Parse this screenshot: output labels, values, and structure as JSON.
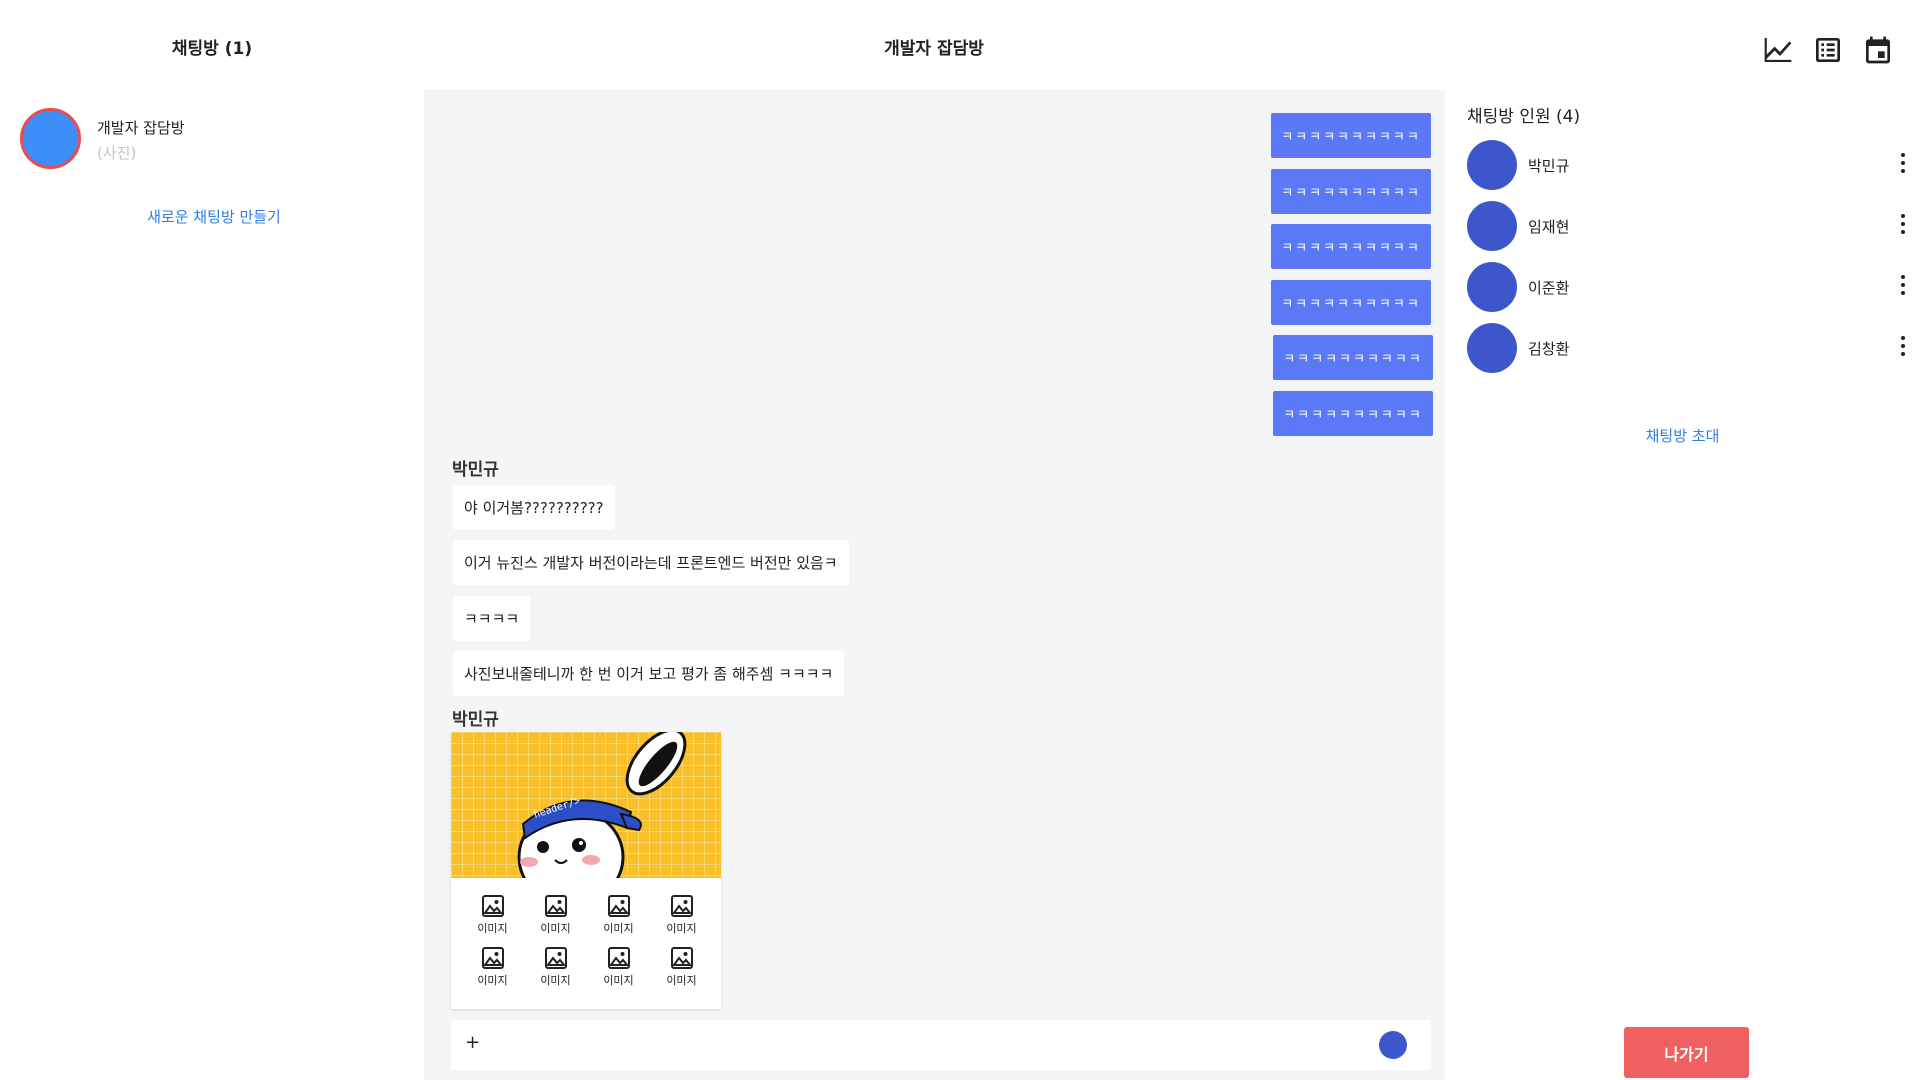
{
  "left_panel": {
    "title": "채팅방 (1)",
    "rooms": [
      {
        "name": "개발자 잡담방",
        "subtitle": "(사진)"
      }
    ],
    "new_room_label": "새로운 채팅방 만들기",
    "avatar_color": "#3d8ef8",
    "avatar_border_color": "#e64e4e"
  },
  "header": {
    "title": "개발자 잡담방",
    "icons": [
      "chart-icon",
      "table-icon",
      "calendar-icon"
    ]
  },
  "chat": {
    "my_messages": [
      "ㅋㅋㅋㅋㅋㅋㅋㅋㅋㅋ",
      "ㅋㅋㅋㅋㅋㅋㅋㅋㅋㅋ",
      "ㅋㅋㅋㅋㅋㅋㅋㅋㅋㅋ",
      "ㅋㅋㅋㅋㅋㅋㅋㅋㅋㅋ",
      "ㅋㅋㅋㅋㅋㅋㅋㅋㅋㅋ",
      "ㅋㅋㅋㅋㅋㅋㅋㅋㅋㅋ"
    ],
    "group1": {
      "sender": "박민규",
      "messages": [
        "야 이거봄??????????",
        "이거 뉴진스 개발자 버전이라는데 프론트엔드 버전만 있음ㅋ",
        "ㅋㅋㅋㅋ",
        "사진보내줄테니까 한 번 이거 보고 평가 좀 해주셈 ㅋㅋㅋㅋ"
      ]
    },
    "group2": {
      "sender": "박민규",
      "image_caption": "header/>",
      "thumbnail_label": "이미지",
      "thumbnail_count": 8
    },
    "input": {
      "plus": "+",
      "placeholder": ""
    },
    "my_bubble_color": "#5b78f6",
    "background": "#f4f5f7"
  },
  "right_panel": {
    "title": "채팅방 인원 (4)",
    "members": [
      "박민규",
      "임재현",
      "이준환",
      "김창환"
    ],
    "invite_label": "채팅방 초대",
    "leave_label": "나가기",
    "member_avatar_color": "#3d56cc",
    "leave_color": "#f06060"
  }
}
